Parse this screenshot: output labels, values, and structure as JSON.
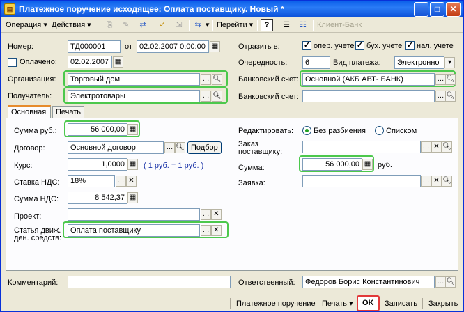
{
  "window": {
    "title": "Платежное поручение исходящее: Оплата поставщику. Новый *",
    "title_icon": "document-icon"
  },
  "toolbar": {
    "operation": "Операция",
    "actions": "Действия",
    "goto": "Перейти",
    "help": "?",
    "client_bank": "Клиент-Банк"
  },
  "header": {
    "number_label": "Номер:",
    "number_value": "ТД000001",
    "from_label": "от",
    "date_value": "02.02.2007 0:00:00",
    "paid_label": "Оплачено:",
    "paid_date": "02.02.2007",
    "org_label": "Организация:",
    "org_value": "Торговый дом",
    "recipient_label": "Получатель:",
    "recipient_value": "Электротовары",
    "reflect_label": "Отразить в:",
    "reflect_oper": "опер. учете",
    "reflect_buh": "бух. учете",
    "reflect_nal": "нал. учете",
    "priority_label": "Очередность:",
    "priority_value": "6",
    "paytype_label": "Вид платежа:",
    "paytype_value": "Электронно",
    "bank_account_label": "Банковский счет:",
    "bank_account_value": "Основной  (АКБ АВТ- БАНК)",
    "bank_account2_label": "Банковский счет:",
    "bank_account2_value": ""
  },
  "tabs": [
    "Основная",
    "Печать"
  ],
  "main": {
    "sum_label": "Сумма руб.:",
    "sum_value": "56 000,00",
    "contract_label": "Договор:",
    "contract_value": "Основной договор",
    "select_button": "Подбор",
    "rate_label": "Курс:",
    "rate_value": "1,0000",
    "rate_note": "( 1 руб. = 1 руб. )",
    "vat_rate_label": "Ставка НДС:",
    "vat_rate_value": "18%",
    "vat_sum_label": "Сумма НДС:",
    "vat_sum_value": "8 542,37",
    "project_label": "Проект:",
    "project_value": "",
    "cashflow_label_1": "Статья движ.",
    "cashflow_label_2": "ден. средств:",
    "cashflow_value": "Оплата поставщику",
    "edit_label": "Редактировать:",
    "edit_opt_1": "Без разбиения",
    "edit_opt_2": "Списком",
    "order_label_1": "Заказ",
    "order_label_2": "поставщику:",
    "order_value": "",
    "sum2_label": "Сумма:",
    "sum2_value": "56 000,00",
    "sum2_unit": "руб.",
    "request_label": "Заявка:",
    "request_value": ""
  },
  "footer": {
    "comment_label": "Комментарий:",
    "comment_value": "",
    "responsible_label": "Ответственный:",
    "responsible_value": "Федоров Борис Константинович"
  },
  "bottom": {
    "payment_order": "Платежное поручение",
    "print": "Печать",
    "ok": "OK",
    "write": "Записать",
    "close": "Закрыть"
  },
  "colors": {
    "highlight_green": "#4cc84c",
    "highlight_red": "#e23a3a",
    "title_blue": "#0a5ee9"
  }
}
